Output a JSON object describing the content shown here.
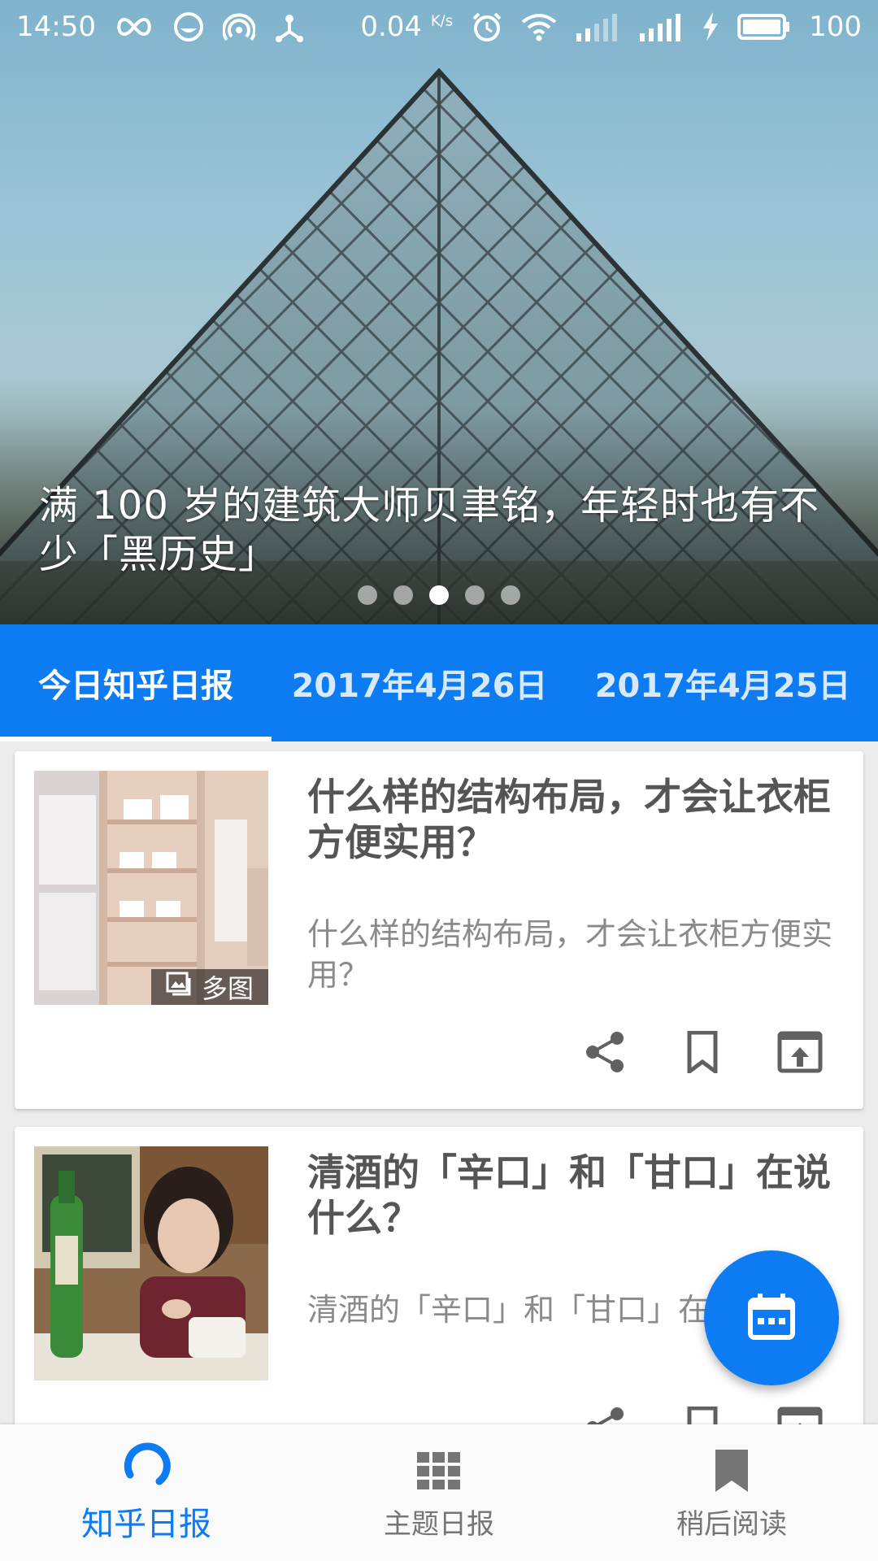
{
  "status_bar": {
    "time": "14:50",
    "speed": "0.04",
    "speed_unit": "K/s",
    "battery": "100",
    "icons": [
      "infinity-icon",
      "face-icon",
      "hotspot-icon",
      "usb-icon",
      "alarm-icon",
      "wifi-icon",
      "signal-icon",
      "signal-icon",
      "charging-icon",
      "battery-icon"
    ]
  },
  "hero": {
    "title": "满 100 岁的建筑大师贝聿铭，年轻时也有不少「黑历史」",
    "dots_count": 5,
    "active_dot": 3
  },
  "tabs": [
    {
      "label": "今日知乎日报",
      "active": true
    },
    {
      "label": "2017年4月26日",
      "active": false
    },
    {
      "label": "2017年4月25日",
      "active": false
    }
  ],
  "stories": [
    {
      "title": "什么样的结构布局，才会让衣柜方便实用？",
      "summary": "什么样的结构布局，才会让衣柜方便实用？",
      "badge": "多图",
      "actions": [
        "share-icon",
        "bookmark-icon",
        "open-external-icon"
      ]
    },
    {
      "title": "清酒的「辛口」和「甘口」在说什么？",
      "summary": "清酒的「辛口」和「甘口」在说什么？",
      "actions": [
        "share-icon",
        "bookmark-icon",
        "open-external-icon"
      ]
    }
  ],
  "fab": {
    "icon": "calendar-icon"
  },
  "bottom_nav": [
    {
      "label": "知乎日报",
      "icon": "refresh-icon",
      "active": true
    },
    {
      "label": "主题日报",
      "icon": "grid-icon",
      "active": false
    },
    {
      "label": "稍后阅读",
      "icon": "bookmark-icon",
      "active": false
    }
  ],
  "colors": {
    "primary": "#0d7cf2",
    "title_text": "#555555",
    "summary_text": "#8a8a8a",
    "nav_inactive": "#757575"
  }
}
